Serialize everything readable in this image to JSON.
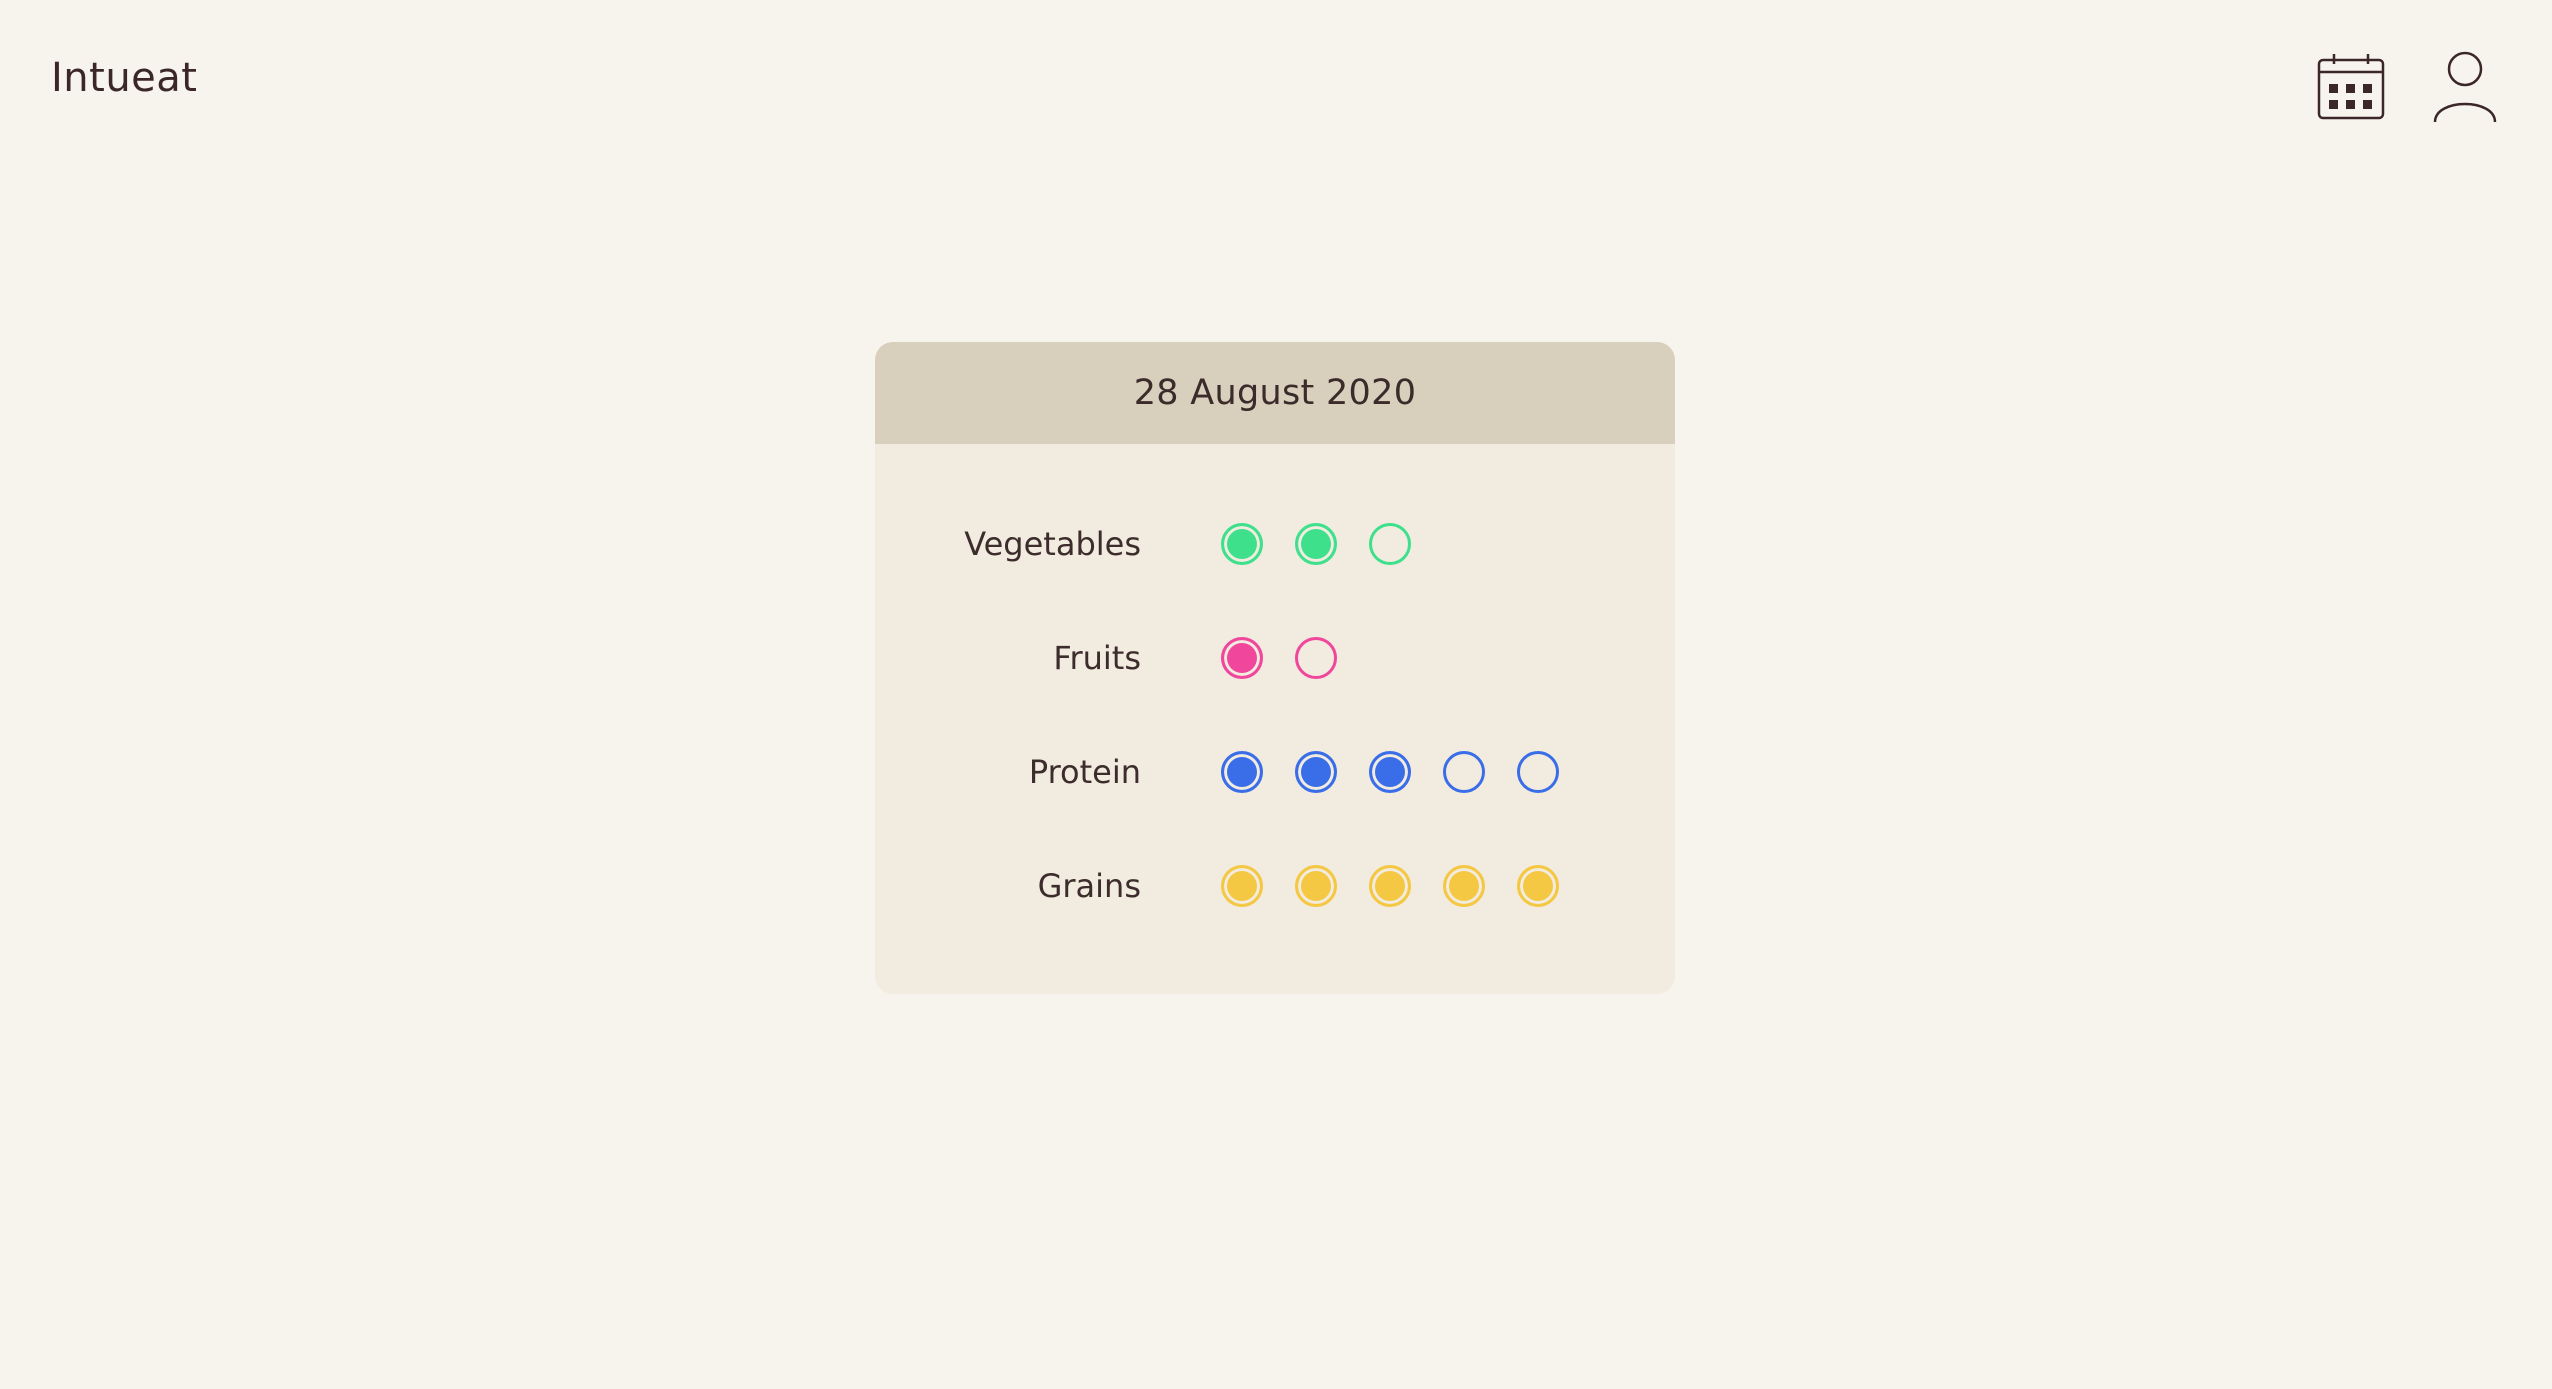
{
  "app": {
    "brand": "Intueat"
  },
  "header": {
    "calendar_icon": "calendar-icon",
    "profile_icon": "user-profile-icon"
  },
  "card": {
    "date": "28 August 2020",
    "groups": [
      {
        "label": "Vegetables",
        "color": "#3fe08b",
        "filled": 2,
        "total": 3
      },
      {
        "label": "Fruits",
        "color": "#f0479c",
        "filled": 1,
        "total": 2
      },
      {
        "label": "Protein",
        "color": "#3a6ee8",
        "filled": 3,
        "total": 5
      },
      {
        "label": "Grains",
        "color": "#f4c843",
        "filled": 5,
        "total": 5
      }
    ]
  },
  "colors": {
    "background": "#f7f4ee",
    "card_body": "#f2ebe0",
    "card_header": "#d8cfbc",
    "text": "#3b2727"
  }
}
